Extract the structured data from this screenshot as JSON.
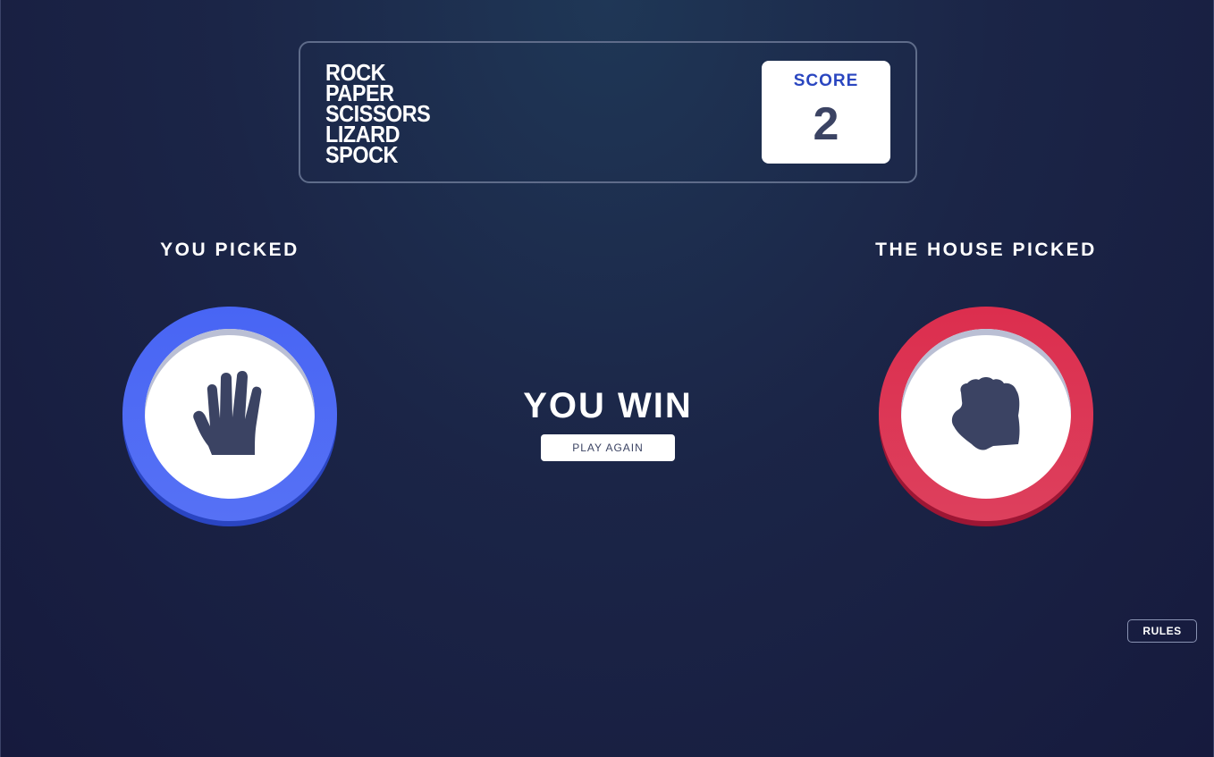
{
  "logo": {
    "words": [
      "ROCK",
      "PAPER",
      "SCISSORS",
      "LIZARD",
      "SPOCK"
    ]
  },
  "score": {
    "label": "SCORE",
    "value": "2"
  },
  "player": {
    "title": "YOU PICKED",
    "choice_icon": "paper-hand-icon",
    "ring_color": "#4865f4"
  },
  "house": {
    "title": "THE HOUSE PICKED",
    "choice_icon": "rock-fist-icon",
    "ring_color": "#dc2e4e"
  },
  "result": {
    "text": "YOU WIN",
    "play_again_label": "PLAY AGAIN"
  },
  "rules": {
    "label": "RULES"
  },
  "colors": {
    "icon": "#3b4363",
    "score_label": "#2a46c0",
    "background": "#1b2547"
  }
}
